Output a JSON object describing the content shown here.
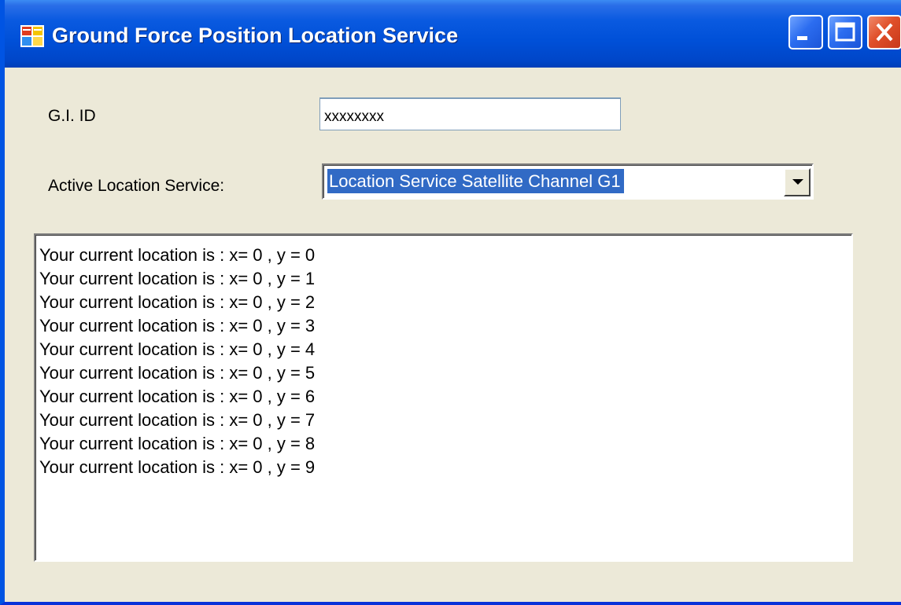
{
  "window": {
    "title": "Ground Force Position Location Service",
    "icon": "windows-form-icon",
    "controls": [
      "minimize-icon",
      "maximize-icon",
      "close-icon"
    ]
  },
  "form": {
    "gi_id_label": "G.I. ID",
    "gi_id_value": "xxxxxxxx",
    "service_label": "Active Location Service:",
    "service_selected": "Location Service Satellite Channel G1"
  },
  "log": {
    "lines": [
      "Your current location is : x= 0 , y = 0",
      "Your current location is : x= 0 , y = 1",
      "Your current location is : x= 0 , y = 2",
      "Your current location is : x= 0 , y = 3",
      "Your current location is : x= 0 , y = 4",
      "Your current location is : x= 0 , y = 5",
      "Your current location is : x= 0 , y = 6",
      "Your current location is : x= 0 , y = 7",
      "Your current location is : x= 0 , y = 8",
      "Your current location is : x= 0 , y = 9"
    ]
  },
  "colors": {
    "titlebar": "#0050d8",
    "window_bg": "#ece9d8",
    "selection": "#316ac5",
    "close_button": "#e0502a"
  }
}
